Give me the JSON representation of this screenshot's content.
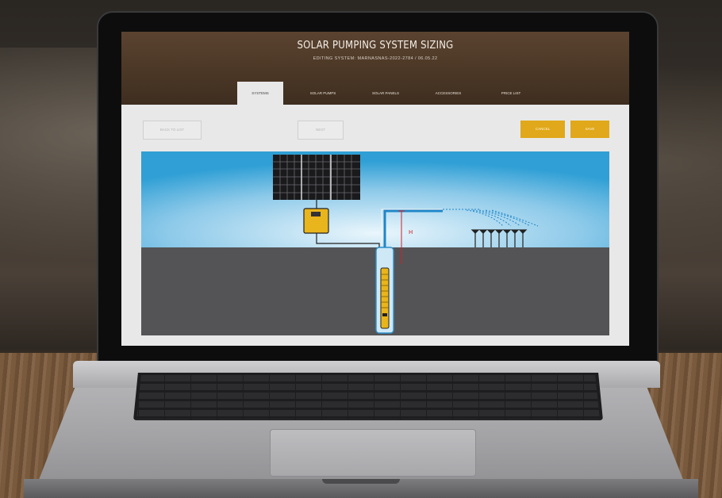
{
  "app": {
    "title": "SOLAR PUMPING SYSTEM SIZING",
    "subtitle": "EDITING SYSTEM: MARNASNAS-2022-2784 / 06.05.22"
  },
  "tabs": [
    {
      "label": "SYSTEMS",
      "active": true
    },
    {
      "label": "SOLAR PUMPS",
      "active": false
    },
    {
      "label": "SOLAR PANELS",
      "active": false
    },
    {
      "label": "ACCESSORIES",
      "active": false
    },
    {
      "label": "PRICE LIST",
      "active": false
    }
  ],
  "toolbar": {
    "back_label": "BACK TO LIST",
    "middle_label": "NEXT",
    "cancel_label": "CANCEL",
    "save_label": "SAVE"
  },
  "diagram": {
    "head_label": "H"
  },
  "colors": {
    "accent": "#e0a81a",
    "header_brown": "#4a3625",
    "sky": "#3aa6d8",
    "ground": "#545456",
    "pipe": "#1f86c8",
    "head_marker": "#d0202a"
  }
}
